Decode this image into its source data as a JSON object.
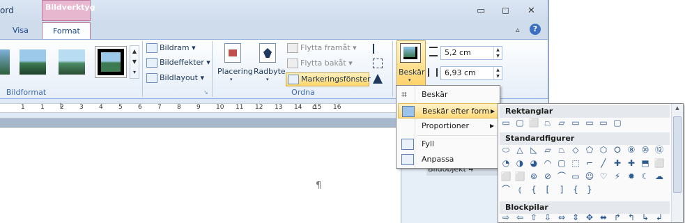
{
  "window": {
    "title_fragment": "ord",
    "contextual_tab_group": "Bildverktyg",
    "controls": {
      "minimize": "▭",
      "restore": "◻",
      "close": "✕",
      "collapse": "▵",
      "help": "?"
    }
  },
  "tabs": [
    {
      "label": "Visa",
      "active": false
    },
    {
      "label": "Format",
      "active": true
    }
  ],
  "ribbon": {
    "bildformat": {
      "label": "Bildformat",
      "commands": [
        {
          "label": "Bildram",
          "icon": "picture-border-icon"
        },
        {
          "label": "Bildeffekter",
          "icon": "picture-effects-icon"
        },
        {
          "label": "Bildlayout",
          "icon": "picture-layout-icon"
        }
      ]
    },
    "ordna": {
      "label": "Ordna",
      "placering": "Placering",
      "radbyte": "Radbyte",
      "flytta_framat": "Flytta framåt",
      "flytta_bakat": "Flytta bakåt",
      "markeringsfonster": "Markeringsfönster"
    },
    "storlek": {
      "beskar": "Beskär",
      "height": "5,2 cm",
      "width": "6,93 cm"
    }
  },
  "crop_menu": {
    "items": [
      {
        "label": "Beskär",
        "icon": "crop-icon",
        "has_submenu": false,
        "highlighted": false
      },
      {
        "label": "Beskär efter form",
        "icon": "crop-shape-icon",
        "has_submenu": true,
        "highlighted": true
      },
      {
        "label": "Proportioner",
        "icon": "",
        "has_submenu": true,
        "highlighted": false
      },
      {
        "label": "Fyll",
        "icon": "fill-icon",
        "has_submenu": false,
        "highlighted": false
      },
      {
        "label": "Anpassa",
        "icon": "fit-icon",
        "has_submenu": false,
        "highlighted": false
      }
    ]
  },
  "shape_menu": {
    "sections": [
      {
        "title": "Rektanglar",
        "shapes": [
          "▭",
          "▢",
          "⬜",
          "⏢",
          "▱",
          "▭",
          "▭",
          "▭",
          "▢"
        ]
      },
      {
        "title": "Standardfigurer",
        "shapes": [
          "⬭",
          "△",
          "◺",
          "▱",
          "⏢",
          "◇",
          "⬠",
          "⬡",
          "⭘",
          "⑧",
          "⑩",
          "⑫",
          "◔",
          "◑",
          "◕",
          "◠",
          "▢",
          "⬚",
          "⌐",
          "╱",
          "✚",
          "✚",
          "⬒",
          "⬜",
          "⬜",
          "⬜",
          "⊚",
          "⊘",
          "⌒",
          "▭",
          "☺",
          "♡",
          "⚡",
          "✹",
          "☾",
          "☁",
          "⌒",
          "⦅",
          "{",
          "[",
          "]",
          "{",
          "}"
        ]
      },
      {
        "title": "Blockpilar",
        "shapes": [
          "⇨",
          "⇦",
          "⇧",
          "⇩",
          "⇔",
          "⇕",
          "✥",
          "⬌",
          "↱",
          "↰",
          "↳",
          "↲"
        ]
      }
    ]
  },
  "document": {
    "pilcrow": "¶",
    "pane_item": "Bildobjekt 4"
  },
  "ruler_numbers": [
    "1",
    "1",
    "2",
    "3",
    "4",
    "5",
    "6",
    "7",
    "8",
    "9",
    "10",
    "11",
    "12",
    "13",
    "14",
    "15",
    "16"
  ]
}
